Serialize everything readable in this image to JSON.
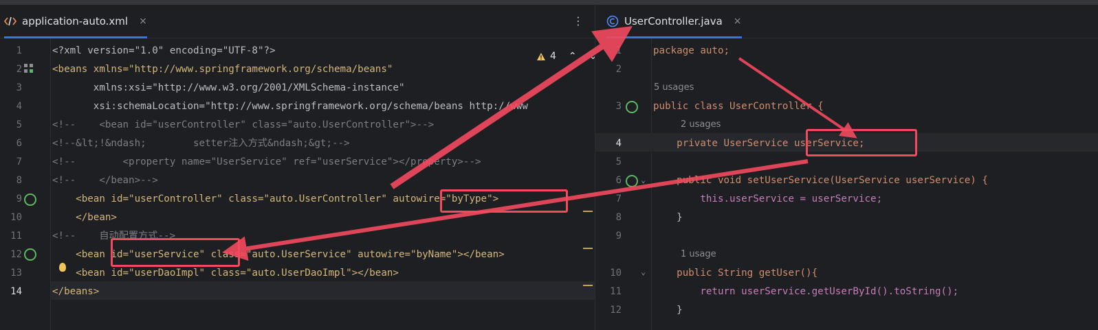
{
  "left_tab": {
    "label": "application-auto.xml",
    "close": "×"
  },
  "right_tab": {
    "label": "UserController.java",
    "close": "×"
  },
  "kebab": "⋮",
  "warnings": {
    "count": "4"
  },
  "left_lines": [
    {
      "n": "1",
      "text": "<?xml version=\"1.0\" encoding=\"UTF-8\"?>"
    },
    {
      "n": "2",
      "text": "<beans xmlns=\"http://www.springframework.org/schema/beans\""
    },
    {
      "n": "3",
      "text": "       xmlns:xsi=\"http://www.w3.org/2001/XMLSchema-instance\""
    },
    {
      "n": "4",
      "text": "       xsi:schemaLocation=\"http://www.springframework.org/schema/beans http://www"
    },
    {
      "n": "5",
      "text": "<!--    <bean id=\"userController\" class=\"auto.UserController\">-->"
    },
    {
      "n": "6",
      "text": "<!--&lt;!&ndash;        setter注入方式&ndash;&gt;-->"
    },
    {
      "n": "7",
      "text": "<!--        <property name=\"UserService\" ref=\"userService\"></property>-->"
    },
    {
      "n": "8",
      "text": "<!--    </bean>-->"
    },
    {
      "n": "9",
      "text": "    <bean id=\"userController\" class=\"auto.UserController\" autowire=\"byType\">"
    },
    {
      "n": "10",
      "text": "    </bean>"
    },
    {
      "n": "11",
      "text": "<!--    自动配置方式-->"
    },
    {
      "n": "12",
      "text": "    <bean id=\"userService\" class=\"auto.UserService\" autowire=\"byName\"></bean>"
    },
    {
      "n": "13",
      "text": "    <bean id=\"userDaoImpl\" class=\"auto.UserDaoImpl\"></bean>"
    },
    {
      "n": "14",
      "text": "</beans>"
    }
  ],
  "right_lines": [
    {
      "n": "1",
      "text": "package auto;"
    },
    {
      "n": "2",
      "text": ""
    },
    {
      "n": "3",
      "text": "public class UserController {"
    },
    {
      "n": "4",
      "text": "    private UserService userService;"
    },
    {
      "n": "5",
      "text": ""
    },
    {
      "n": "6",
      "text": "    public void setUserService(UserService userService) {"
    },
    {
      "n": "7",
      "text": "        this.userService = userService;"
    },
    {
      "n": "8",
      "text": "    }"
    },
    {
      "n": "9",
      "text": ""
    },
    {
      "n": "10",
      "text": "    public String getUser(){"
    },
    {
      "n": "11",
      "text": "        return userService.getUserById().toString();"
    },
    {
      "n": "12",
      "text": "    }"
    }
  ],
  "usages": {
    "class": "5 usages",
    "field": "2 usages",
    "method": "1 usage"
  },
  "colors": {
    "accent": "#3574f0",
    "annotation": "#f44a5e",
    "bg": "#1e1f22"
  }
}
